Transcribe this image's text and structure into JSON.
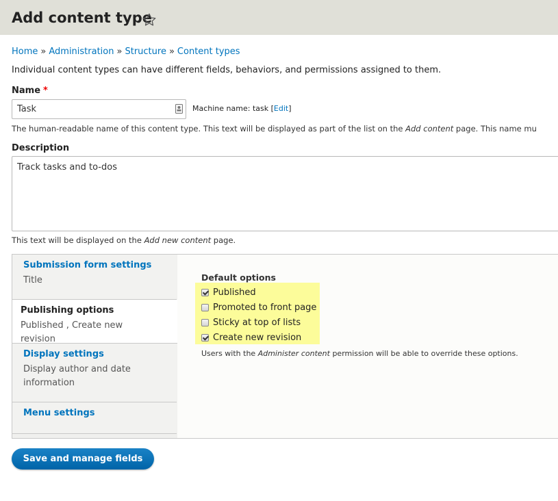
{
  "page": {
    "title": "Add content type"
  },
  "breadcrumb": [
    "Home",
    "Administration",
    "Structure",
    "Content types"
  ],
  "intro_text": "Individual content types can have different fields, behaviors, and permissions assigned to them.",
  "name_field": {
    "label": "Name",
    "required_marker": "*",
    "value": "Task",
    "machine_name_label": "Machine name: task",
    "edit_link": "Edit",
    "help_prefix": "The human-readable name of this content type. This text will be displayed as part of the list on the ",
    "help_em": "Add content",
    "help_suffix": " page. This name mu"
  },
  "description_field": {
    "label": "Description",
    "value": "Track tasks and to-dos",
    "help_prefix": "This text will be displayed on the ",
    "help_em": "Add new content",
    "help_suffix": " page."
  },
  "vertical_tabs": [
    {
      "title": "Submission form settings",
      "summary": "Title",
      "selected": false
    },
    {
      "title": "Publishing options",
      "summary": "Published , Create new revision",
      "selected": true
    },
    {
      "title": "Display settings",
      "summary": "Display author and date information",
      "selected": false
    },
    {
      "title": "Menu settings",
      "summary": "",
      "selected": false
    }
  ],
  "publishing_pane": {
    "group_label": "Default options",
    "options": [
      {
        "label": "Published",
        "checked": true
      },
      {
        "label": "Promoted to front page",
        "checked": false
      },
      {
        "label": "Sticky at top of lists",
        "checked": false
      },
      {
        "label": "Create new revision",
        "checked": true
      }
    ],
    "help_prefix": "Users with the ",
    "help_em": "Administer content",
    "help_suffix": " permission will be able to override these options."
  },
  "actions": {
    "save_label": "Save and manage fields"
  },
  "colors": {
    "link": "#0074bd",
    "header_bg": "#e0e0d8",
    "highlight": "#fcfc9a",
    "required": "#ee0000",
    "primary_button": "#0071b8"
  },
  "icons": {
    "favorite": "star-outline-icon",
    "input_badge": "contact-card-icon"
  }
}
